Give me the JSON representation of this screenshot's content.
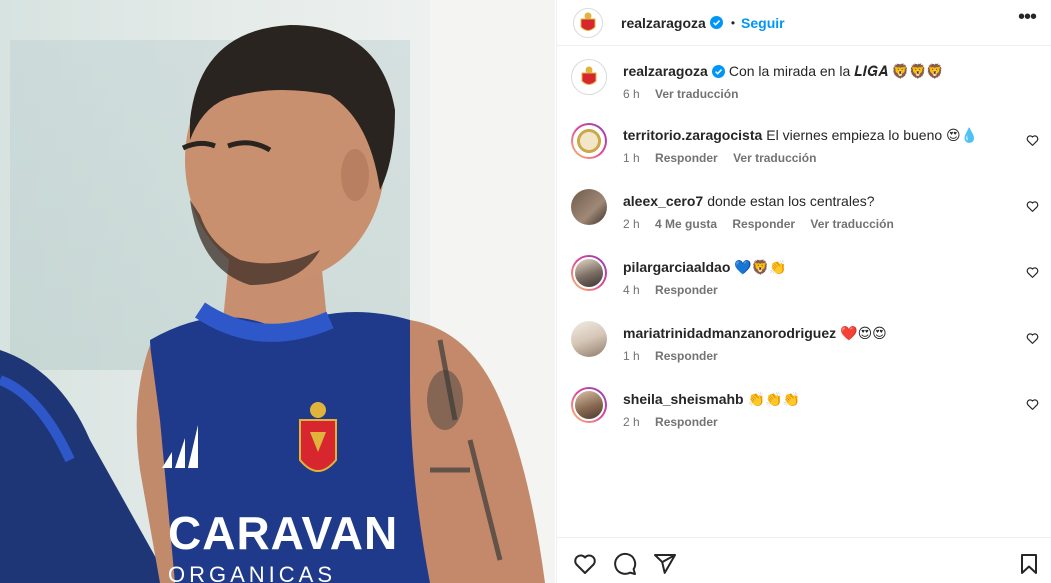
{
  "post": {
    "username": "realzaragoza",
    "follow_label": "Seguir",
    "dot": "•",
    "more_label": "•••"
  },
  "caption": {
    "username": "realzaragoza",
    "text": "Con la mirada en la 𝑳𝑰𝑮𝑨 🦁🦁🦁",
    "time": "6 h",
    "translate": "Ver traducción"
  },
  "comments": [
    {
      "username": "territorio.zaragocista",
      "text": "El viernes empieza lo bueno 😍💧",
      "time": "1 h",
      "likes": "",
      "reply": "Responder",
      "translate": "Ver traducción"
    },
    {
      "username": "aleex_cero7",
      "text": "donde estan los centrales?",
      "time": "2 h",
      "likes": "4 Me gusta",
      "reply": "Responder",
      "translate": "Ver traducción"
    },
    {
      "username": "pilargarciaaldao",
      "text": "💙🦁👏",
      "time": "4 h",
      "likes": "",
      "reply": "Responder",
      "translate": ""
    },
    {
      "username": "mariatrinidadmanzanorodriguez",
      "text": "❤️😍😍",
      "time": "1 h",
      "likes": "",
      "reply": "Responder",
      "translate": ""
    },
    {
      "username": "sheila_sheismahb",
      "text": "👏👏👏",
      "time": "2 h",
      "likes": "",
      "reply": "Responder",
      "translate": ""
    }
  ],
  "photo": {
    "shirt_text": "CARAVAN",
    "shirt_text2": "ORGANICAS"
  },
  "colors": {
    "accent": "#0095f6",
    "verified": "#0095f6",
    "jersey": "#1f3a8a",
    "crest_red": "#d7262e",
    "crest_gold": "#e0b43b"
  },
  "icons": [
    "verified-badge-icon",
    "more-options-icon",
    "heart-icon",
    "comment-icon",
    "share-icon",
    "bookmark-icon"
  ]
}
